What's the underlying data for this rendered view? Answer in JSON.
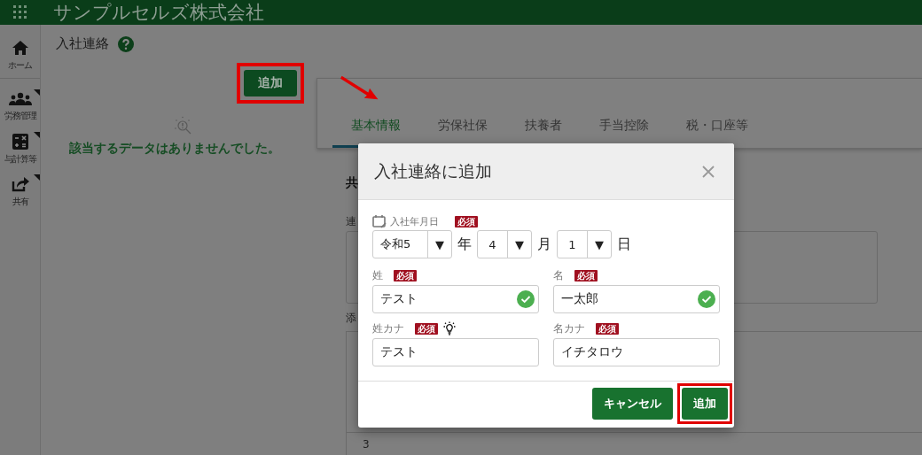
{
  "app_bar": {
    "title": "サンプルセルズ株式会社"
  },
  "sidebar": {
    "items": [
      {
        "label": "ホーム",
        "has_submenu": false
      },
      {
        "label": "労務管理",
        "has_submenu": true
      },
      {
        "label": "与計算等",
        "has_submenu": true
      },
      {
        "label": "共有",
        "has_submenu": true
      }
    ]
  },
  "page": {
    "title": "入社連絡",
    "add_button": {
      "label": "追加",
      "highlighted": true
    },
    "empty_message": "該当するデータはありませんでした。"
  },
  "detail_panel": {
    "tabs": [
      {
        "label": "基本情報",
        "selected": true
      },
      {
        "label": "労保社保",
        "selected": false
      },
      {
        "label": "扶養者",
        "selected": false
      },
      {
        "label": "手当控除",
        "selected": false
      },
      {
        "label": "税・口座等",
        "selected": false
      }
    ],
    "section_heading": "共",
    "field_label": "連",
    "attachments_label": "添",
    "table_rows": [
      "3"
    ]
  },
  "dialog": {
    "title": "入社連絡に追加",
    "hire_date": {
      "label": "入社年月日",
      "required": "必須",
      "parts": [
        {
          "value": "令和5",
          "arrow": "▼",
          "unit": "年"
        },
        {
          "value": "4",
          "arrow": "▼",
          "unit": "月"
        },
        {
          "value": "1",
          "arrow": "▼",
          "unit": "日"
        }
      ]
    },
    "fields": [
      {
        "label": "姓",
        "required": "必須",
        "value": "テスト",
        "valid": true,
        "hint": false
      },
      {
        "label": "名",
        "required": "必須",
        "value": "一太郎",
        "valid": true,
        "hint": false
      },
      {
        "label": "姓カナ",
        "required": "必須",
        "value": "テスト",
        "valid": false,
        "hint": true
      },
      {
        "label": "名カナ",
        "required": "必須",
        "value": "イチタロウ",
        "valid": false,
        "hint": false
      }
    ],
    "buttons": [
      {
        "label": "キャンセル",
        "highlighted": false
      },
      {
        "label": "追加",
        "highlighted": true
      }
    ]
  }
}
